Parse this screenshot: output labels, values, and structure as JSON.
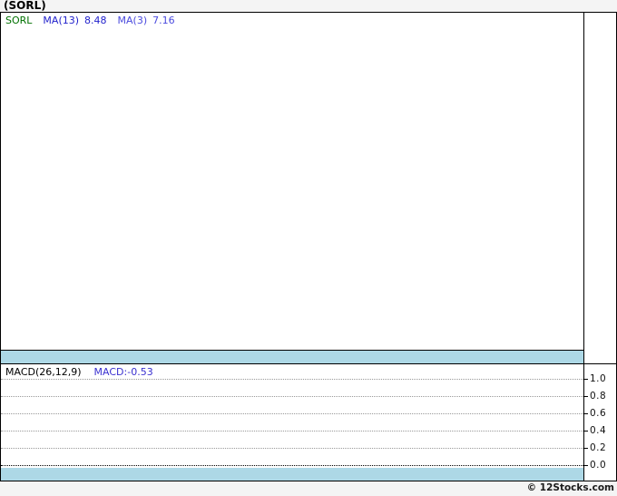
{
  "header": {
    "title": "(SORL)"
  },
  "main_panel": {
    "legend": {
      "symbol": "SORL",
      "ma13_label": "MA(13)",
      "ma13_value": "8.48",
      "ma3_label": "MA(3)",
      "ma3_value": "7.16"
    }
  },
  "macd_panel": {
    "legend_label": "MACD(26,12,9)",
    "legend_value": "MACD:-0.53",
    "axis_labels": [
      "1.0",
      "0.8",
      "0.6",
      "0.4",
      "0.2",
      "0.0"
    ]
  },
  "footer": {
    "copyright": "© 12Stocks.com"
  },
  "colors": {
    "band_blue": "#ADD8E6",
    "symbol_text": "#007000",
    "ma13_text": "#2222CC",
    "ma3_text": "#4A4ADE",
    "macd_value_text": "#3A30D0",
    "gridline": "#999999",
    "zero_line": "#000000",
    "frame_border": "#000000",
    "page_background": "#F4F4F4"
  },
  "chart_data": [
    {
      "type": "line",
      "title": "(SORL) price panel",
      "series": [
        {
          "name": "MA(13)",
          "latest_value": 8.48,
          "values": []
        },
        {
          "name": "MA(3)",
          "latest_value": 7.16,
          "values": []
        }
      ],
      "xlabel": "",
      "ylabel": "",
      "grid": false,
      "note": "Plot area is rendered empty (no candles, MA lines or axis ticks visible); only legend values shown and a light-blue strip along the bottom of the panel."
    },
    {
      "type": "line",
      "title": "MACD(26,12,9)",
      "series": [
        {
          "name": "MACD",
          "latest_value": -0.53,
          "values": []
        }
      ],
      "xlabel": "",
      "ylabel": "",
      "ylim": [
        0.0,
        1.0
      ],
      "yticks": [
        1.0,
        0.8,
        0.6,
        0.4,
        0.2,
        0.0
      ],
      "grid": true,
      "legend_position": "top-left",
      "note": "No MACD curve visible; dotted gridlines at each 0.2 step, darker dotted zero line, light-blue strip along the bottom."
    }
  ]
}
